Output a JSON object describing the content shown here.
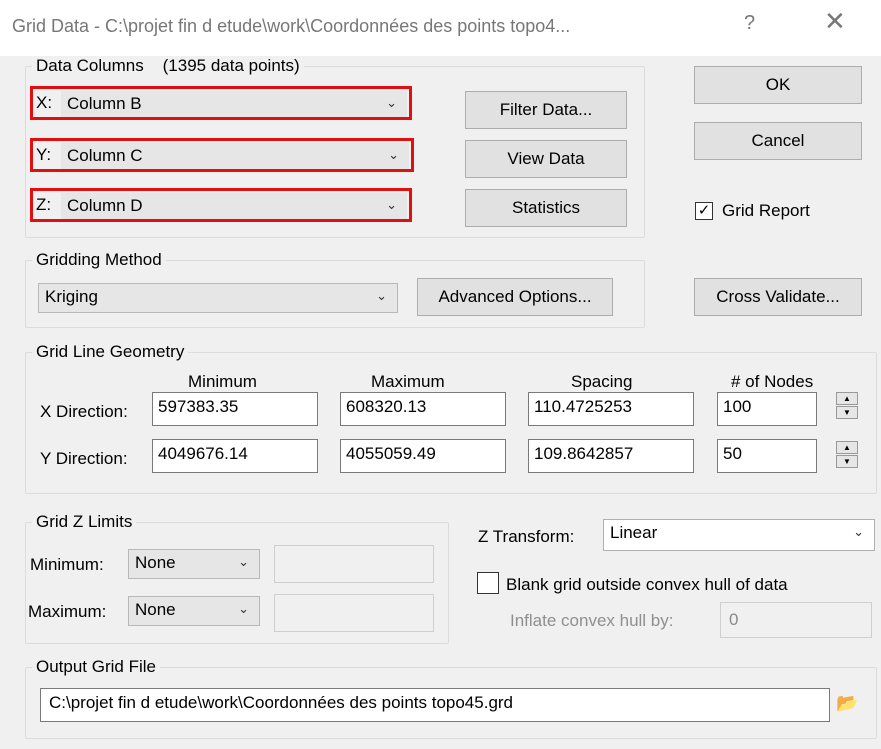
{
  "window": {
    "title": "Grid Data - C:\\projet fin d etude\\work\\Coordonnées des points topo4...",
    "help": "?",
    "close": "✕"
  },
  "data_columns": {
    "legend": "Data Columns",
    "count": "(1395 data points)",
    "x": {
      "prefix": "X:",
      "value": "Column B"
    },
    "y": {
      "prefix": "Y:",
      "value": "Column C"
    },
    "z": {
      "prefix": "Z:",
      "value": "Column D"
    },
    "filter_label": "Filter Data...",
    "view_label": "View Data",
    "stats_label": "Statistics"
  },
  "actions": {
    "ok_label": "OK",
    "cancel_label": "Cancel",
    "grid_report_label": "Grid Report",
    "grid_report_checked": true,
    "cross_validate_label": "Cross Validate..."
  },
  "gridding": {
    "legend": "Gridding Method",
    "method": "Kriging",
    "advanced_label": "Advanced Options..."
  },
  "geometry": {
    "legend": "Grid Line Geometry",
    "headers": {
      "minimum": "Minimum",
      "maximum": "Maximum",
      "spacing": "Spacing",
      "nodes": "# of Nodes"
    },
    "x": {
      "label": "X Direction:",
      "minimum": "597383.35",
      "maximum": "608320.13",
      "spacing": "110.4725253",
      "nodes": "100"
    },
    "y": {
      "label": "Y Direction:",
      "minimum": "4049676.14",
      "maximum": "4055059.49",
      "spacing": "109.8642857",
      "nodes": "50"
    }
  },
  "z_limits": {
    "legend": "Grid Z Limits",
    "minimum_label": "Minimum:",
    "minimum_value": "None",
    "maximum_label": "Maximum:",
    "maximum_value": "None"
  },
  "z_transform": {
    "label": "Z Transform:",
    "value": "Linear"
  },
  "blank": {
    "label": "Blank grid outside convex hull of data",
    "checked": false,
    "inflate_label": "Inflate convex hull by:",
    "inflate_value": "0"
  },
  "output": {
    "legend": "Output Grid File",
    "path": "C:\\projet fin d etude\\work\\Coordonnées des points topo45.grd"
  },
  "icons": {
    "chevron": "chevron-down-icon",
    "folder": "folder-open-icon",
    "check": "checkmark-icon"
  }
}
